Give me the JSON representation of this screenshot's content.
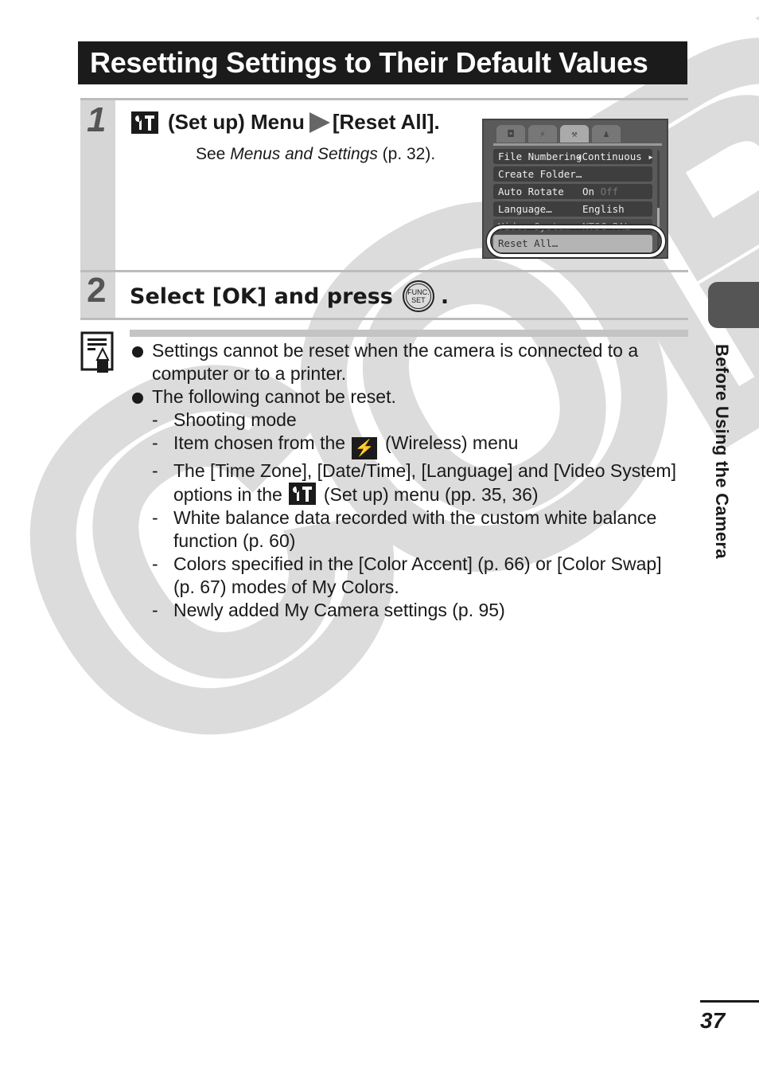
{
  "title": "Resetting Settings to Their Default Values",
  "steps": [
    {
      "number": "1",
      "heading_icon": "setup-menu-icon",
      "heading_part1": "(Set up) Menu",
      "heading_arrow_icon": "right-triangle-icon",
      "heading_part2": "[Reset All].",
      "sub_prefix": "See ",
      "sub_italic": "Menus and Settings",
      "sub_suffix": " (p. 32).",
      "camera_screen": {
        "tabs": [
          {
            "icon": "camera-icon",
            "glyph": "◘"
          },
          {
            "icon": "wireless-icon",
            "glyph": "⚡"
          },
          {
            "icon": "setup-icon",
            "glyph": "⚒",
            "active": true
          },
          {
            "icon": "my-camera-icon",
            "glyph": "♟"
          }
        ],
        "rows": [
          {
            "label": "File Numbering",
            "value": "◂Continuous ▸"
          },
          {
            "label": "Create Folder…",
            "value": ""
          },
          {
            "label": "Auto Rotate",
            "value": "On",
            "value_dim": "Off"
          },
          {
            "label": "Language…",
            "value": "English"
          },
          {
            "label": "Video System",
            "value": "NTSC PAL"
          },
          {
            "label": "Reset All…",
            "value": "",
            "selected": true
          }
        ]
      }
    },
    {
      "number": "2",
      "heading_before": "Select [OK] and press",
      "button_icon": "func-set-button-icon",
      "button_text_top": "FUNC.",
      "button_text_bottom": "SET",
      "heading_after": "."
    }
  ],
  "note": {
    "icon": "note-pencil-icon",
    "bullets": [
      {
        "text": "Settings cannot be reset when the camera is connected to a computer or to a printer."
      },
      {
        "text": "The following cannot be reset."
      }
    ],
    "sub_items": [
      {
        "text": "Shooting mode"
      },
      {
        "before": "Item chosen from the",
        "icon": "wireless-icon",
        "after": "(Wireless) menu"
      },
      {
        "before": "The [Time Zone], [Date/Time], [Language] and [Video System] options in the",
        "icon": "setup-menu-icon",
        "after": "(Set up) menu (pp. 35, 36)"
      },
      {
        "text": "White balance data recorded with the custom white balance function (p. 60)"
      },
      {
        "text": "Colors specified in the [Color Accent] (p. 66) or [Color Swap] (p. 67) modes of My Colors."
      },
      {
        "text": "Newly added My Camera settings (p. 95)"
      }
    ]
  },
  "side_tab_label": "Before Using the Camera",
  "page_number": "37",
  "watermark": "COPY"
}
